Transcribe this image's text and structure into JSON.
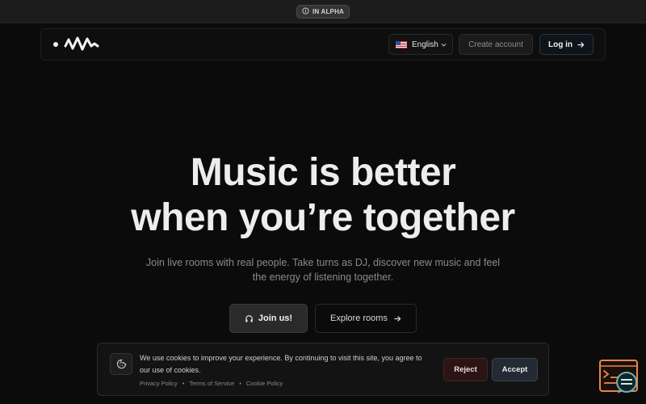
{
  "banner": {
    "badge_label": "IN ALPHA"
  },
  "nav": {
    "language": "English",
    "create_account": "Create account",
    "login": "Log in"
  },
  "hero": {
    "title_line1": "Music is better",
    "title_line2": "when you’re together",
    "subtitle_line1": "Join live rooms with real people. Take turns as DJ, discover new music and feel",
    "subtitle_line2": "the energy of listening together.",
    "join_button": "Join us!",
    "explore_button": "Explore rooms"
  },
  "cookie": {
    "message_line1": "We use cookies to improve your experience. By continuing to visit this site, you agree to",
    "message_line2": "our use of cookies.",
    "links": [
      "Privacy Policy",
      "Terms of Service",
      "Cookie Policy"
    ],
    "separator": "•",
    "reject": "Reject",
    "accept": "Accept"
  },
  "icons": {
    "badge": "info-circle-icon",
    "logo": "waveform-logo-icon",
    "flag": "us-flag-icon",
    "language_chevron": "chevron-down-icon",
    "login_arrow": "arrow-right-icon",
    "join": "headphones-icon",
    "explore_arrow": "arrow-right-icon",
    "cookie": "cookie-icon",
    "dev_widget": "terminal-chat-icon"
  },
  "colors": {
    "background": "#0b0b0b",
    "reject_accent": "#4a2323",
    "accept_accent": "#3a4452",
    "dev_widget_orange": "#e8864c",
    "dev_widget_teal": "#6fb0b6"
  }
}
